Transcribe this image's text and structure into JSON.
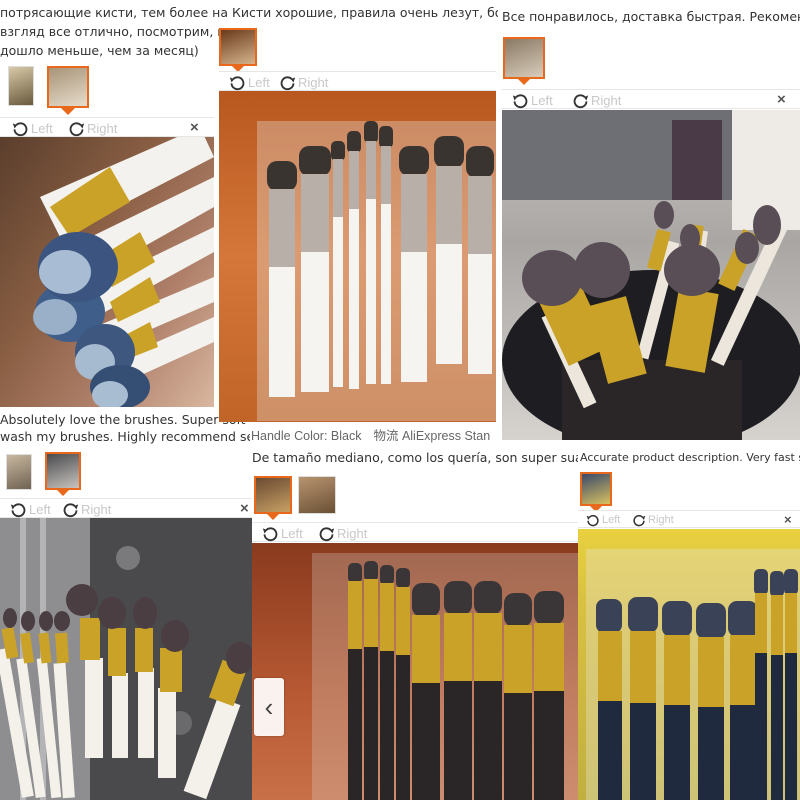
{
  "reviews": [
    {
      "text_lines": [
        "потрясающие кисти, тем более на Кисти хорошие, правила очень лезут, большие",
        "взгляд все отлично, посмотрим, ка",
        "дошло меньше, чем за месяц)"
      ],
      "toolbar": {
        "left": "Left",
        "right": "Right",
        "close": "×"
      }
    },
    {
      "text_lines": [
        "Все понравилось, доставка быстрая. Рекомен"
      ],
      "toolbar": {
        "left": "Left",
        "right": "Right",
        "close": "×"
      }
    },
    {
      "text_lines": [
        "Absolutely love the brushes. Super soft and",
        "wash my brushes. Highly recommend seller,"
      ],
      "toolbar": {
        "left": "Left",
        "right": "Right",
        "close": "×"
      }
    },
    {
      "meta": {
        "handle": "Handle Color: Black",
        "shipping": "物流 AliExpress Stan"
      },
      "toolbar": {
        "left": "Left",
        "right": "Right",
        "close": "×"
      }
    },
    {
      "text_lines": [
        "De tamaño mediano, como los quería, son super suaves"
      ],
      "toolbar": {
        "left": "Left",
        "right": "Right",
        "close": "×"
      },
      "prev_label": "‹"
    },
    {
      "text_lines": [
        "Accurate product description. Very fast shipping"
      ],
      "toolbar": {
        "left": "Left",
        "right": "Right",
        "close": "×"
      }
    }
  ],
  "icons": {
    "rotate_left": "rotate-left-icon",
    "rotate_right": "rotate-right-icon",
    "close": "close-icon",
    "prev": "chevron-left-icon"
  },
  "colors": {
    "accent": "#e8691c",
    "gold": "#c9a227",
    "toolbar_text": "#c8c8c8"
  }
}
